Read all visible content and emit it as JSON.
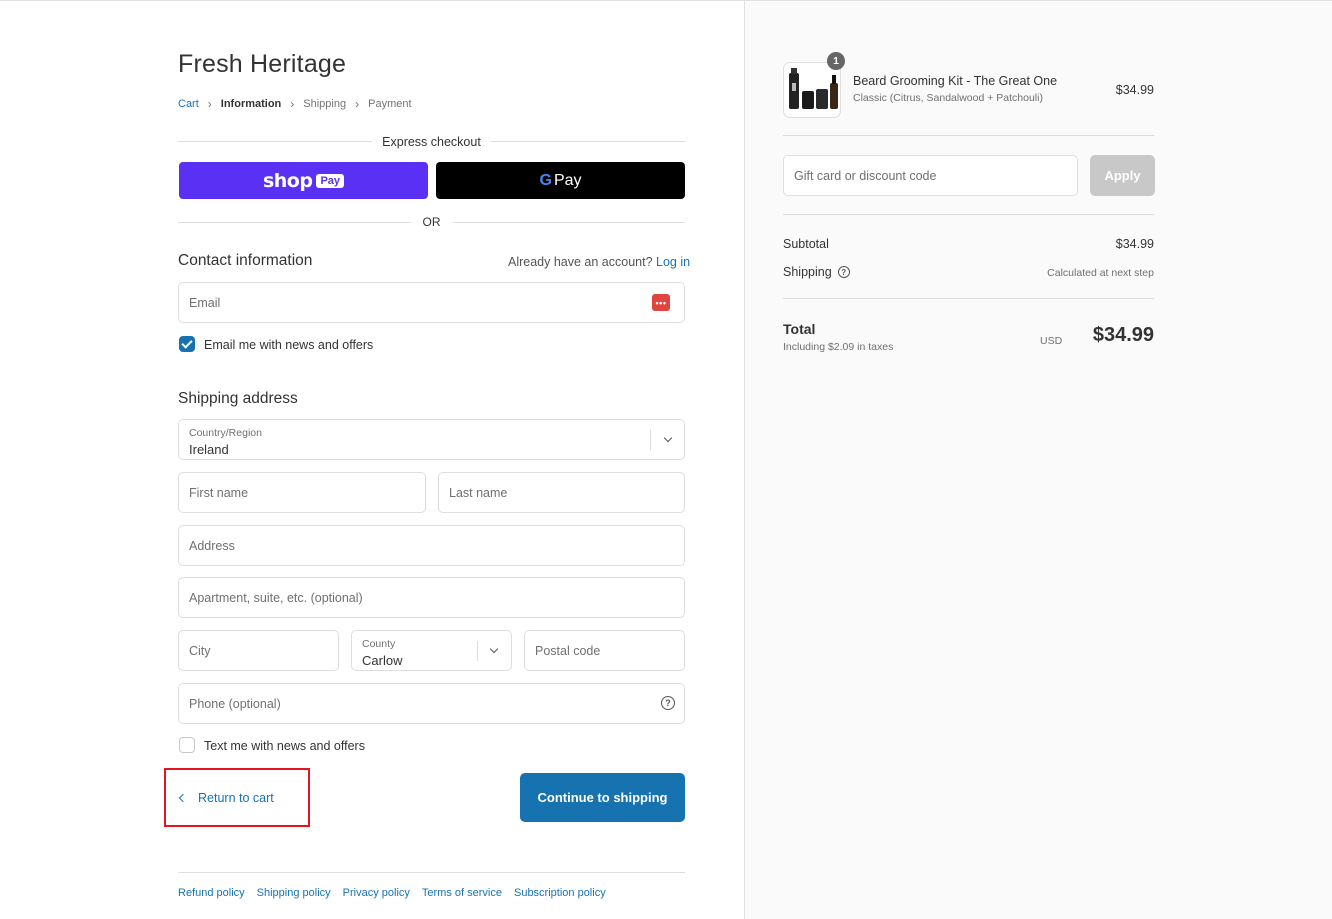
{
  "store": {
    "title": "Fresh Heritage"
  },
  "breadcrumb": {
    "items": [
      "Cart",
      "Information",
      "Shipping",
      "Payment"
    ]
  },
  "express": {
    "label": "Express checkout",
    "shop_pay": "shop",
    "shop_pay_badge": "Pay",
    "gpay_g": "G",
    "gpay_text": "Pay",
    "or_label": "OR"
  },
  "contact": {
    "heading": "Contact information",
    "account_prompt": "Already have an account?",
    "login_link": "Log in",
    "email_placeholder": "Email",
    "email_icon": "•••",
    "news_checkbox_label": "Email me with news and offers",
    "news_checked": true
  },
  "shipping": {
    "heading": "Shipping address",
    "country_label": "Country/Region",
    "country_value": "Ireland",
    "first_name": "First name",
    "last_name": "Last name",
    "address": "Address",
    "apartment": "Apartment, suite, etc. (optional)",
    "city": "City",
    "county_label": "County",
    "county_value": "Carlow",
    "postal": "Postal code",
    "phone": "Phone (optional)",
    "sms_label": "Text me with news and offers",
    "sms_checked": false
  },
  "actions": {
    "return": "Return to cart",
    "continue": "Continue to shipping"
  },
  "footer": {
    "links": [
      "Refund policy",
      "Shipping policy",
      "Privacy policy",
      "Terms of service",
      "Subscription policy"
    ]
  },
  "order": {
    "quantity": "1",
    "product_name": "Beard Grooming Kit - The Great One",
    "product_variant": "Classic (Citrus, Sandalwood + Patchouli)",
    "product_price": "$34.99",
    "discount_placeholder": "Gift card or discount code",
    "apply": "Apply",
    "subtotal_label": "Subtotal",
    "subtotal": "$34.99",
    "shipping_label": "Shipping",
    "shipping_value": "Calculated at next step",
    "total_label": "Total",
    "tax_note": "Including $2.09 in taxes",
    "currency": "USD",
    "total": "$34.99"
  },
  "colors": {
    "accent": "#1773b0",
    "shop_pay": "#5a31f4",
    "gpay": "#000000",
    "highlight": "#e5141e"
  }
}
